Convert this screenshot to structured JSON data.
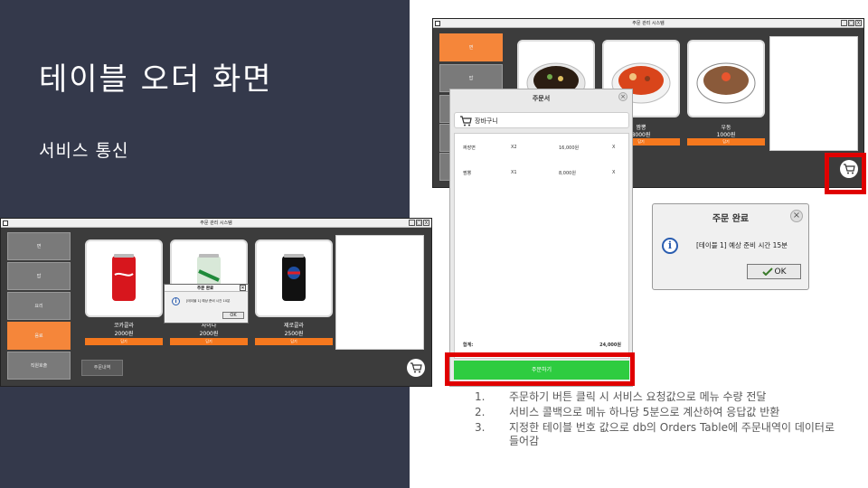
{
  "slide": {
    "title": "테이블 오더 화면",
    "subtitle": "서비스 통신"
  },
  "app_window": {
    "title": "주문 관리 시스템",
    "controls": [
      "_",
      "□",
      "X"
    ]
  },
  "bottom_window": {
    "sidebar": [
      {
        "label": "면",
        "active": false
      },
      {
        "label": "밥",
        "active": false
      },
      {
        "label": "요리",
        "active": false
      },
      {
        "label": "음료",
        "active": true
      },
      {
        "label": "직원호출",
        "active": false
      }
    ],
    "products": [
      {
        "name": "코카콜라",
        "price": "2000원",
        "button": "담기",
        "icon": "cola-can-icon"
      },
      {
        "name": "사이다",
        "price": "2000원",
        "button": "담기",
        "icon": "sprite-can-icon"
      },
      {
        "name": "제로콜라",
        "price": "2500원",
        "button": "담기",
        "icon": "pepsi-can-icon"
      }
    ],
    "order_history_button": "주문내역",
    "small_dialog": {
      "title": "주문 완료",
      "message": "[테이블 1] 예상 준비 시간 10분",
      "ok": "OK"
    }
  },
  "top_window": {
    "sidebar": [
      {
        "label": "면",
        "active": true
      },
      {
        "label": "밥",
        "active": false
      }
    ],
    "products": [
      {
        "name": "짜장면",
        "price": "",
        "button": "",
        "icon": "jjajangmyeon-icon"
      },
      {
        "name": "짬뽕",
        "price": "8000원",
        "button": "담기",
        "icon": "jjamppong-icon"
      },
      {
        "name": "우동",
        "price": "1000원",
        "button": "담기",
        "icon": "udon-icon"
      }
    ]
  },
  "order_sheet": {
    "title": "주문서",
    "close": "×",
    "cart_label": "장바구니",
    "items": [
      {
        "name": "짜장면",
        "qty": "X2",
        "price": "16,000원",
        "remove": "X"
      },
      {
        "name": "짬뽕",
        "qty": "X1",
        "price": "8,000원",
        "remove": "X"
      }
    ],
    "total_label": "합계:",
    "total_value": "24,000원",
    "order_button": "주문하기"
  },
  "completion_dialog": {
    "title": "주문 완료",
    "close": "×",
    "message": "[테이블 1] 예상 준비 시간 15분",
    "ok": "OK"
  },
  "notes": [
    {
      "num": "1.",
      "text": "주문하기 버튼 클릭 시 서비스 요청값으로 메뉴 수량 전달"
    },
    {
      "num": "2.",
      "text": "서비스 콜백으로 메뉴 하나당 5분으로 계산하여 응답값 반환"
    },
    {
      "num": "3.",
      "text": "지정한 테이블 번호 값으로 db의 Orders Table에 주문내역이 데이터로 들어감"
    }
  ],
  "colors": {
    "slide_bg": "#34394b",
    "accent_orange": "#f5863a",
    "highlight_red": "#e00000",
    "order_green": "#2ecc40"
  }
}
